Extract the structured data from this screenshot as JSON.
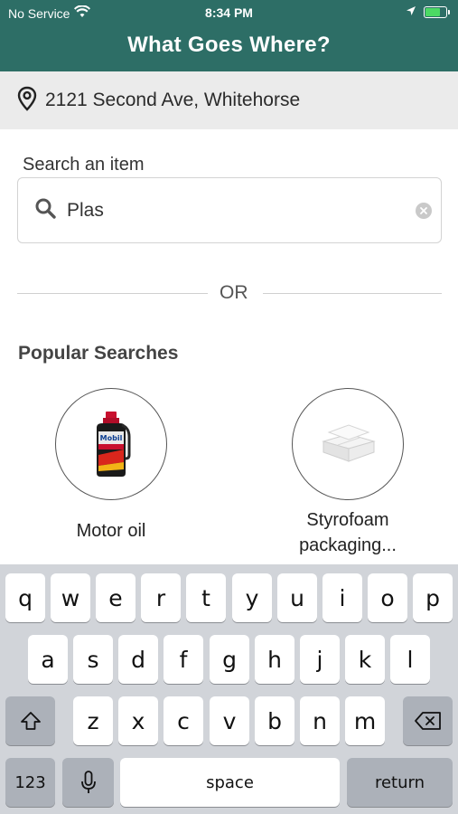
{
  "status_bar": {
    "carrier": "No Service",
    "time": "8:34 PM"
  },
  "header": {
    "title": "What Goes Where?"
  },
  "location": {
    "address": "2121 Second Ave, Whitehorse"
  },
  "search": {
    "label": "Search an item",
    "value": "Plas"
  },
  "divider": {
    "text": "OR"
  },
  "popular": {
    "label": "Popular Searches",
    "items": [
      {
        "name": "Motor oil"
      },
      {
        "name": "Styrofoam packaging..."
      }
    ]
  },
  "keyboard": {
    "row1": [
      "q",
      "w",
      "e",
      "r",
      "t",
      "y",
      "u",
      "i",
      "o",
      "p"
    ],
    "row2": [
      "a",
      "s",
      "d",
      "f",
      "g",
      "h",
      "j",
      "k",
      "l"
    ],
    "row3": [
      "z",
      "x",
      "c",
      "v",
      "b",
      "n",
      "m"
    ],
    "numbers_label": "123",
    "space_label": "space",
    "return_label": "return"
  },
  "colors": {
    "header_bg": "#2d6e66",
    "location_bg": "#ebebeb",
    "keyboard_bg": "#d1d4d9"
  }
}
